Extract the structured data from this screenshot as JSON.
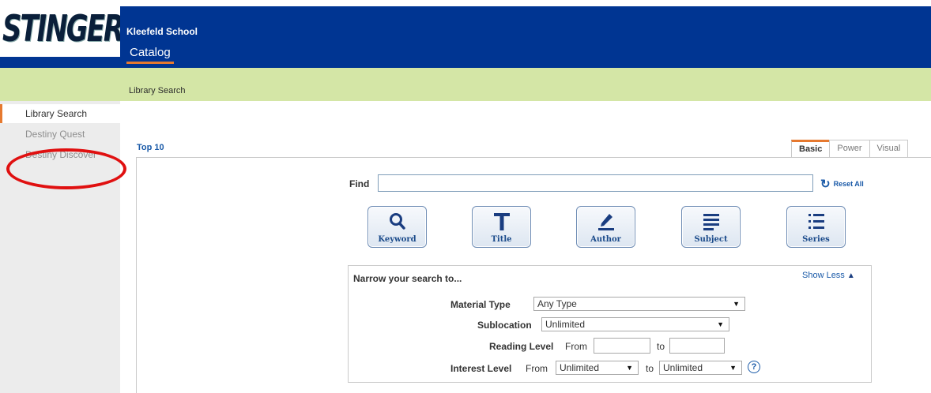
{
  "header": {
    "logo_text": "STINGERS",
    "school_name": "Kleefeld School",
    "nav_tab": "Catalog"
  },
  "breadcrumb": "Library Search",
  "sidebar": {
    "items": [
      {
        "label": "Library Search",
        "active": true
      },
      {
        "label": "Destiny Quest",
        "active": false
      },
      {
        "label": "Destiny Discover",
        "active": false
      }
    ]
  },
  "main": {
    "top10": "Top 10",
    "mode_tabs": [
      "Basic",
      "Power",
      "Visual"
    ],
    "find": {
      "label": "Find",
      "value": "",
      "reset_label": "Reset All"
    },
    "search_buttons": [
      {
        "label": "Keyword",
        "icon": "magnifier-icon"
      },
      {
        "label": "Title",
        "icon": "letter-t-icon"
      },
      {
        "label": "Author",
        "icon": "pen-icon"
      },
      {
        "label": "Subject",
        "icon": "lines-icon"
      },
      {
        "label": "Series",
        "icon": "numbered-list-icon"
      }
    ],
    "narrow": {
      "title": "Narrow your search to...",
      "toggle_label": "Show Less",
      "material_type": {
        "label": "Material Type",
        "value": "Any Type"
      },
      "sublocation": {
        "label": "Sublocation",
        "value": "Unlimited"
      },
      "reading_level": {
        "label": "Reading Level",
        "from_label": "From",
        "to_label": "to",
        "from_value": "",
        "to_value": ""
      },
      "interest_level": {
        "label": "Interest Level",
        "from_label": "From",
        "to_label": "to",
        "from_value": "Unlimited",
        "to_value": "Unlimited"
      }
    }
  },
  "colors": {
    "header_bg": "#003592",
    "subbar_bg": "#d4e6a6",
    "accent": "#e6792f",
    "annotation": "#e01010",
    "link": "#1a5aa8"
  }
}
